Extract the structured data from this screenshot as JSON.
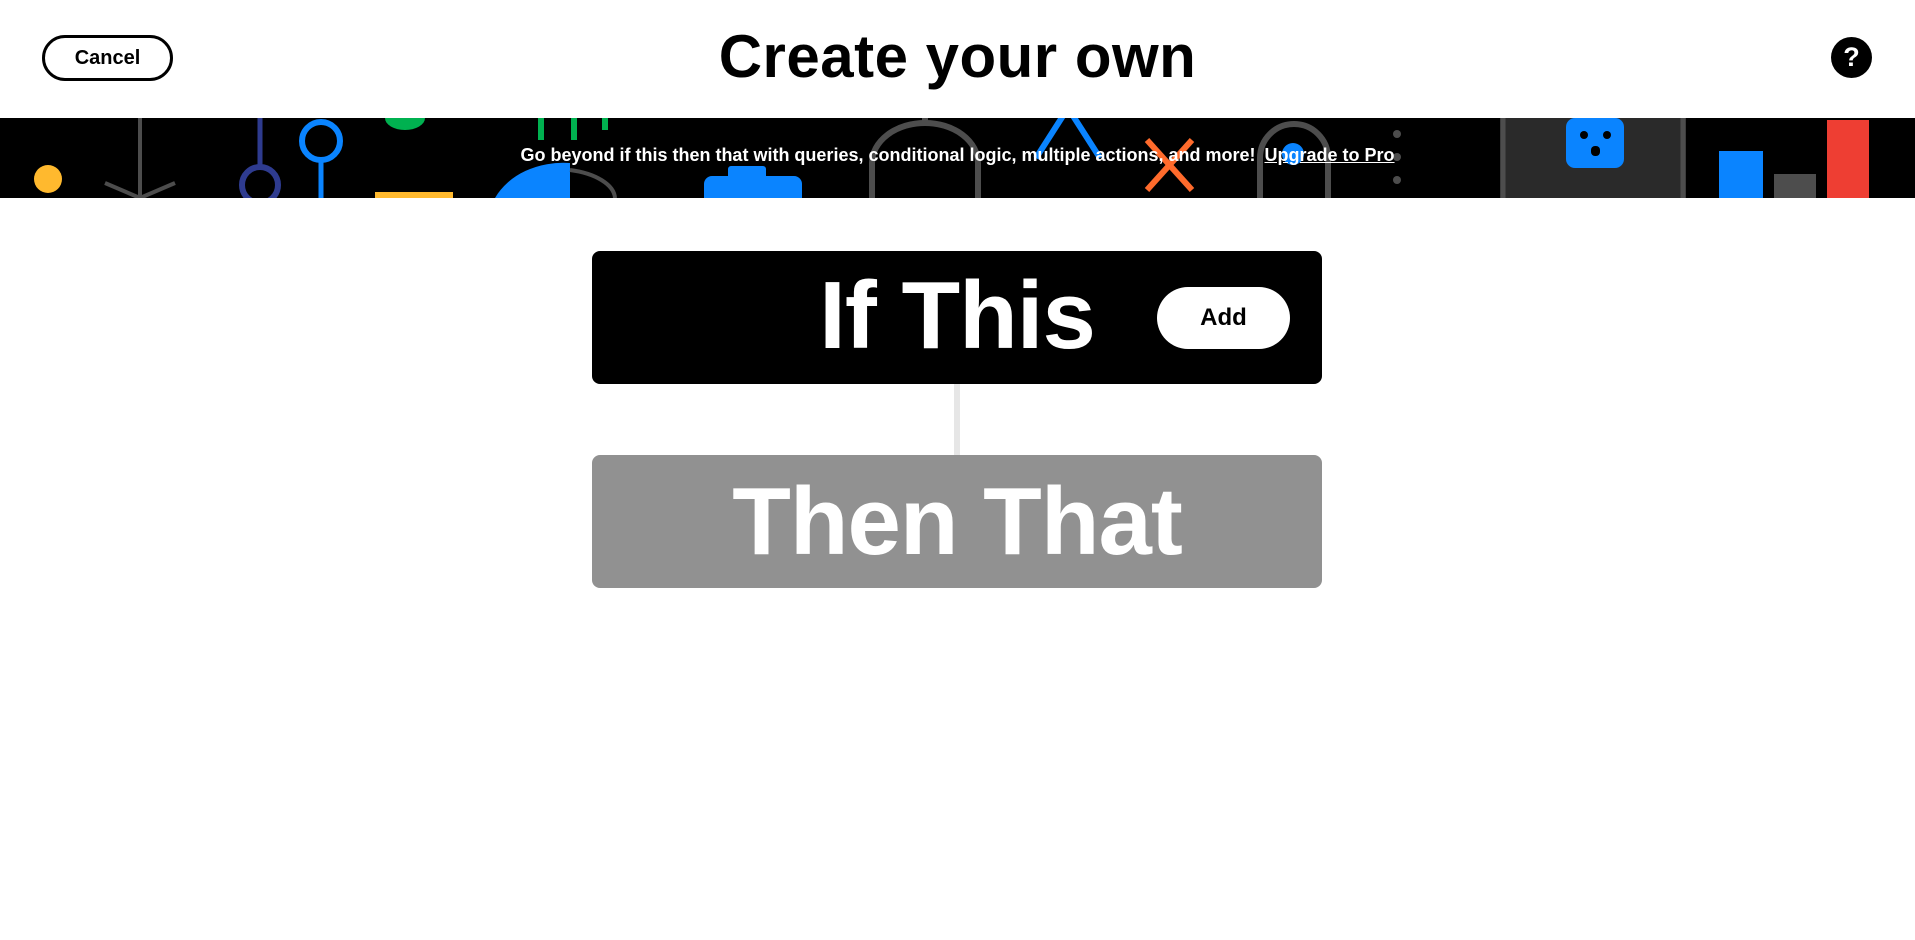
{
  "header": {
    "cancel_label": "Cancel",
    "title": "Create your own",
    "help_icon": "question-icon",
    "help_glyph": "?"
  },
  "banner": {
    "message": "Go beyond if this then that with queries, conditional logic, multiple actions, and more!",
    "link_label": "Upgrade to Pro",
    "decor_colors": [
      "#FFB92E",
      "#4D4D4D",
      "#2E3B8F",
      "#0A84FF",
      "#00B150",
      "#FF6B2C",
      "#EE3E33"
    ]
  },
  "trigger": {
    "label": "If This",
    "add_label": "Add",
    "color": "#000000"
  },
  "action": {
    "label": "Then That",
    "color": "#919191"
  }
}
